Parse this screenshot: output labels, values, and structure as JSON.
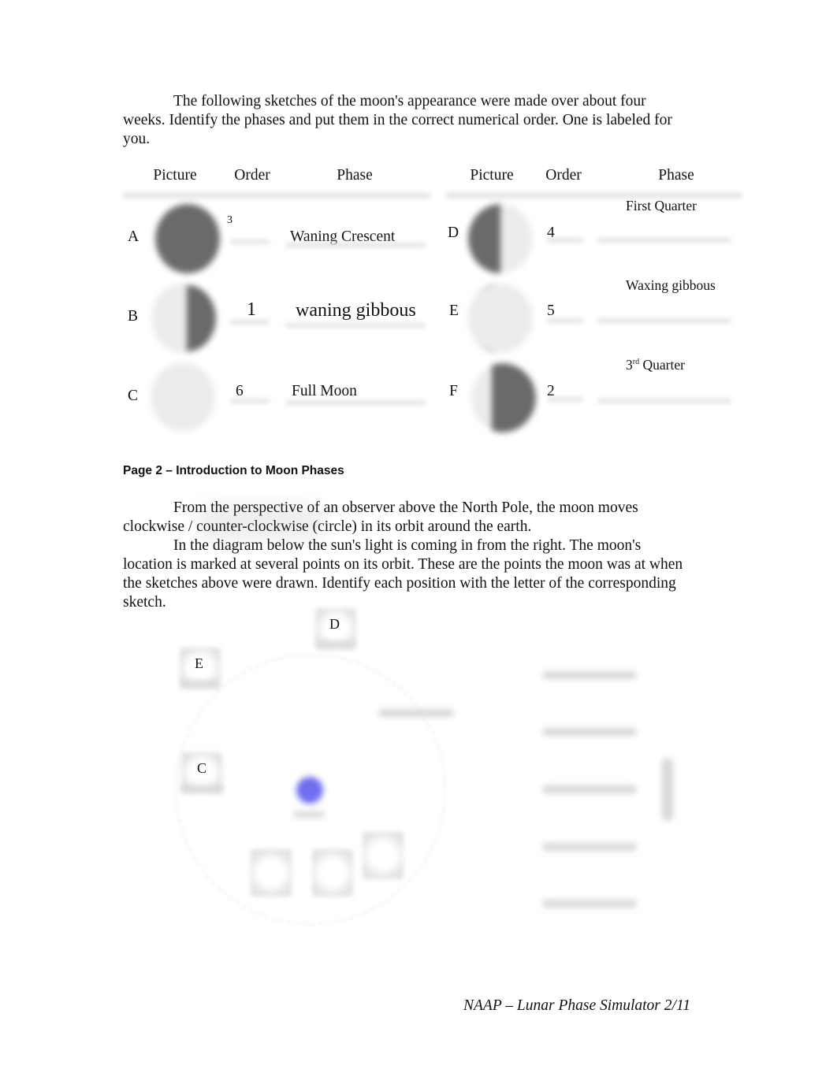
{
  "intro": {
    "text": "The following sketches of the moon's appearance were made over about four weeks. Identify the phases and put them in the correct numerical order. One is labeled for you."
  },
  "table": {
    "headers": [
      "Picture",
      "Order",
      "Phase"
    ],
    "left_rows": [
      {
        "letter": "A",
        "order": "3",
        "phase": "Waning Crescent",
        "moon": "mostly-dark"
      },
      {
        "letter": "B",
        "order": "1",
        "phase": "waning gibbous",
        "moon": "dark-right-crescent"
      },
      {
        "letter": "C",
        "order": "6",
        "phase": "Full Moon",
        "moon": "full-light"
      }
    ],
    "right_rows": [
      {
        "letter": "D",
        "order": "4",
        "phase": "First Quarter",
        "moon": "dark-left-half"
      },
      {
        "letter": "E",
        "order": "5",
        "phase": "Waxing gibbous",
        "moon": "dark-left-crescent"
      },
      {
        "letter": "F",
        "order": "2",
        "phase_prefix": "3",
        "phase_sup": "rd",
        "phase_suffix": " Quarter",
        "moon": "dark-right-half"
      }
    ]
  },
  "section": {
    "title": "Page 2 – Introduction to Moon Phases"
  },
  "body": {
    "p1": "From the perspective of an observer above the North Pole, the moon moves clockwise / counter-clockwise (circle) in its orbit around the earth.",
    "p2": "In the diagram below the sun's light is coming in from the right. The moon's location is marked at several points on its orbit. These are the points the moon was at when the sketches above were drawn. Identify each position with the letter of the corresponding sketch."
  },
  "diagram": {
    "position_labels": [
      "D",
      "E",
      "C"
    ],
    "earth_color": "#6f6ff0"
  },
  "footer": {
    "text": "NAAP – Lunar Phase Simulator 2/11"
  }
}
